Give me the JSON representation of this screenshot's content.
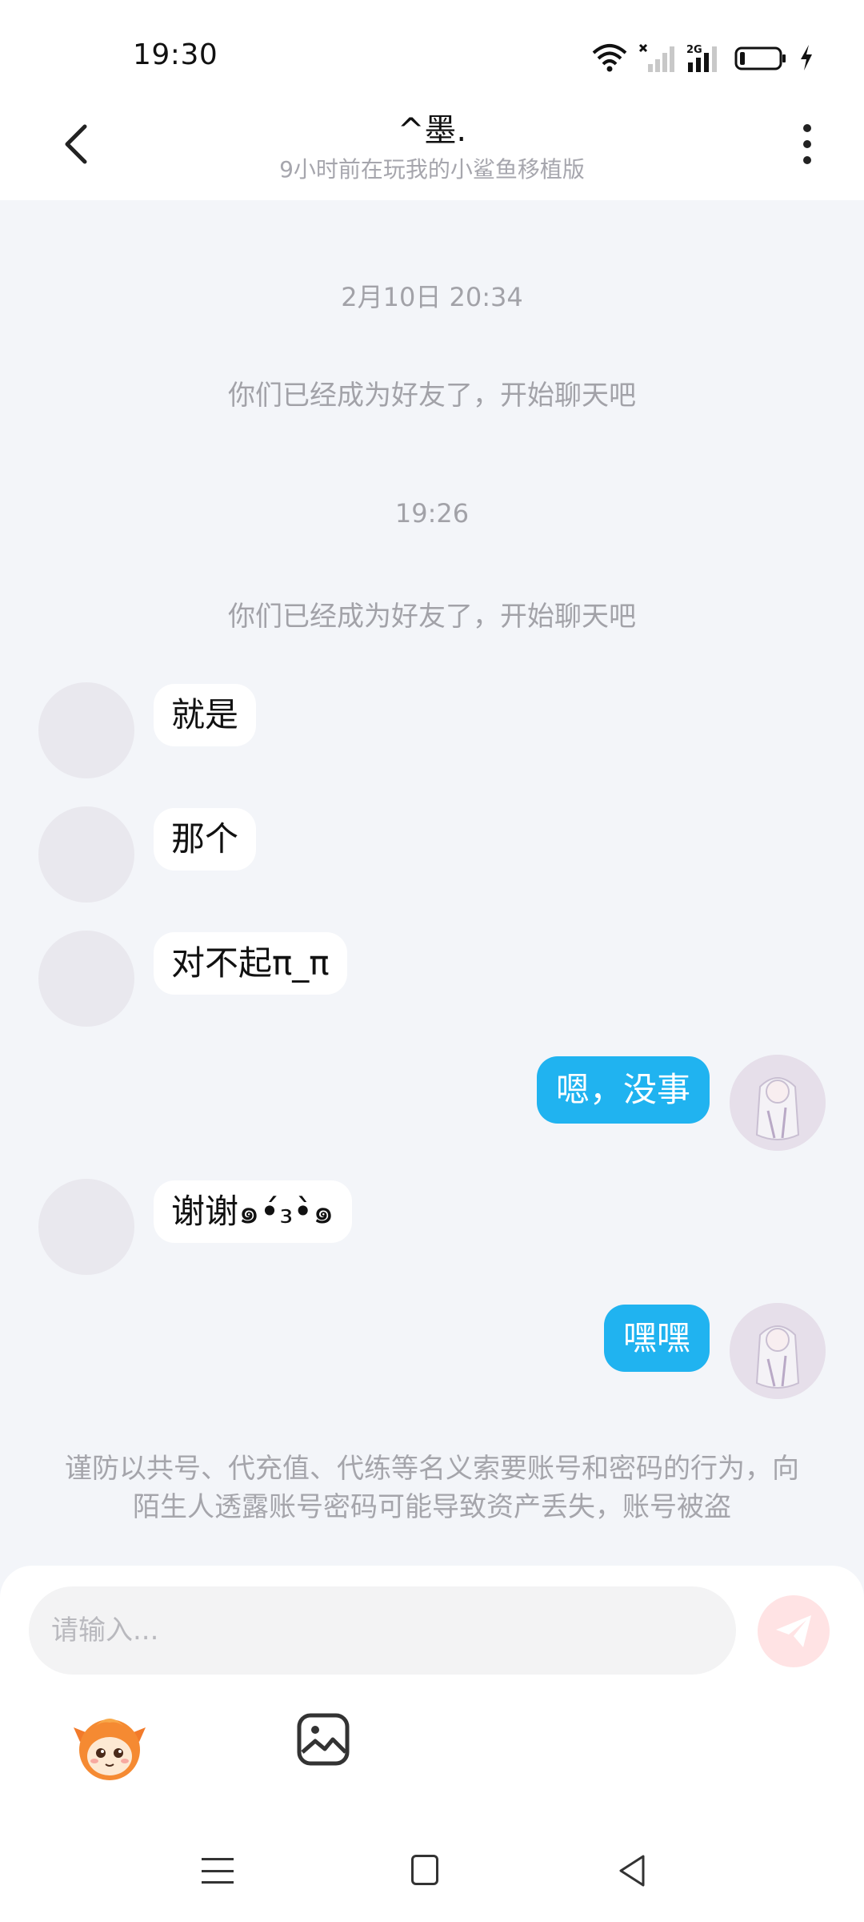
{
  "status_bar": {
    "time": "19:30",
    "network_label": "2G"
  },
  "header": {
    "title": "^墨.",
    "subtitle": "9小时前在玩我的小鲨鱼移植版"
  },
  "chat": {
    "timestamps": [
      "2月10日 20:34",
      "19:26"
    ],
    "system_messages": [
      "你们已经成为好友了，开始聊天吧",
      "你们已经成为好友了，开始聊天吧"
    ],
    "messages": [
      {
        "side": "left",
        "text": "就是"
      },
      {
        "side": "left",
        "text": "那个"
      },
      {
        "side": "left",
        "text": "对不起π_π"
      },
      {
        "side": "right",
        "text": "嗯，没事"
      },
      {
        "side": "left",
        "text": "谢谢๑•́₃•̀๑"
      },
      {
        "side": "right",
        "text": "嘿嘿"
      }
    ],
    "warning": "谨防以共号、代充值、代练等名义索要账号和密码的行为，向陌生人透露账号密码可能导致资产丢失，账号被盗"
  },
  "input_bar": {
    "placeholder": "请输入..."
  },
  "colors": {
    "accent_blue": "#20b3f0",
    "send_inactive": "#ffe3e4",
    "background": "#f3f5f9"
  },
  "icons": {
    "back": "chevron-left-icon",
    "more": "more-vertical-icon",
    "send": "paper-plane-icon",
    "sticker": "mascot-sticker-icon",
    "image": "image-icon"
  }
}
